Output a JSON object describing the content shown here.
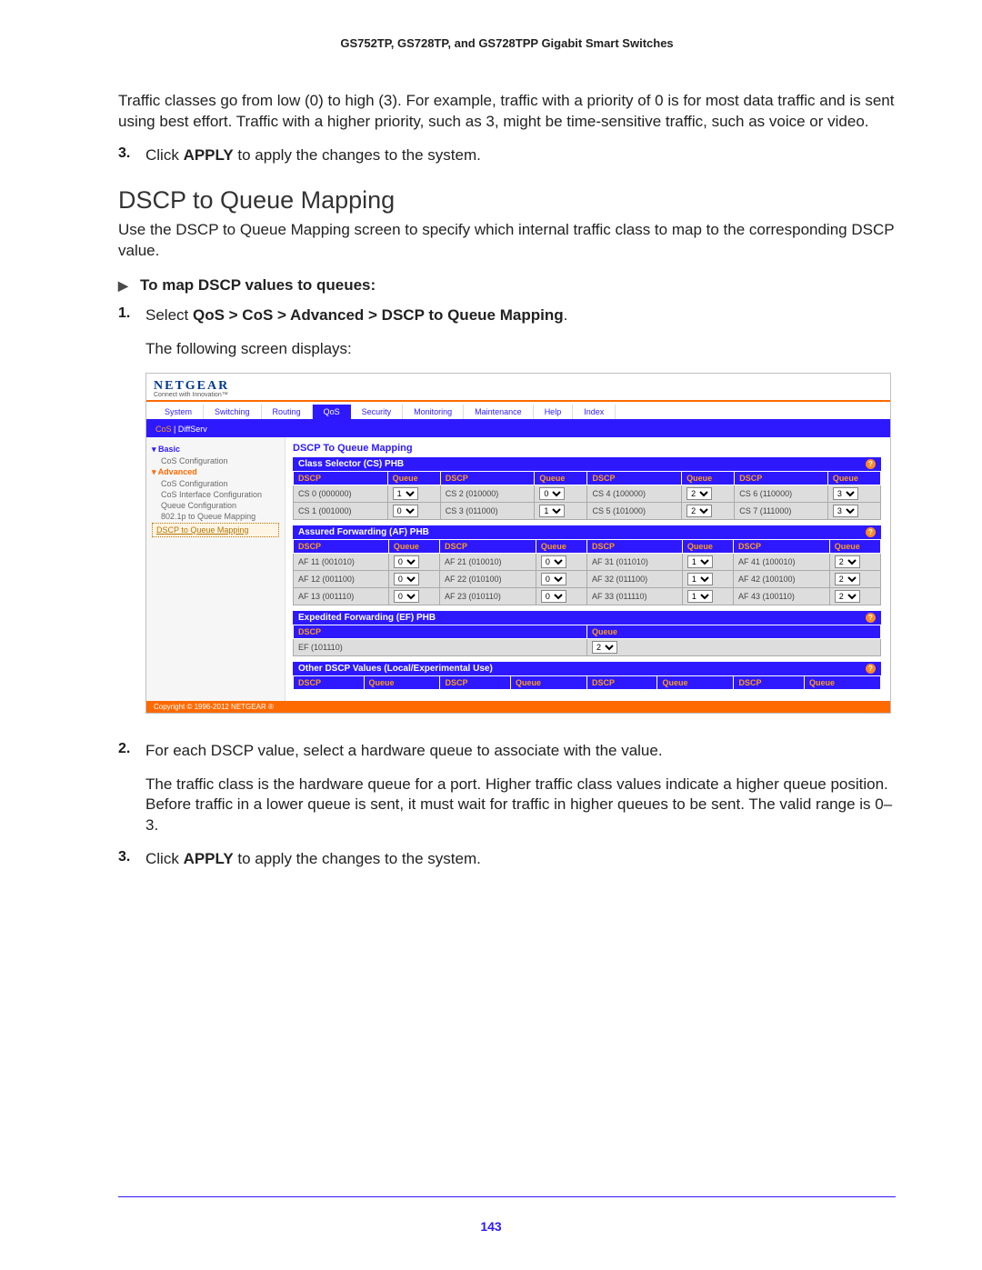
{
  "header": "GS752TP, GS728TP, and GS728TPP Gigabit Smart Switches",
  "intro_para": "Traffic classes go from low (0) to high (3). For example, traffic with a priority of 0 is for most data traffic and is sent using best effort. Traffic with a higher priority, such as 3, might be time-sensitive traffic, such as voice or video.",
  "step3_top_num": "3.",
  "step3_top_a": "Click ",
  "step3_top_b": "APPLY",
  "step3_top_c": " to apply the changes to the system.",
  "section_title": "DSCP to Queue Mapping",
  "section_intro": "Use the DSCP to Queue Mapping screen to specify which internal traffic class to map to the corresponding DSCP value.",
  "howto_label": "To map DSCP values to queues:",
  "step1_num": "1.",
  "step1_a": "Select ",
  "step1_path": "QoS > CoS > Advanced > DSCP to Queue Mapping",
  "step1_c": ".",
  "step1_follow": "The following screen displays:",
  "step2_num": "2.",
  "step2_a": "For each DSCP value, select a hardware queue to associate with the value.",
  "step2_para": "The traffic class is the hardware queue for a port. Higher traffic class values indicate a higher queue position. Before traffic in a lower queue is sent, it must wait for traffic in higher queues to be sent. The valid range is 0–3.",
  "step3_num": "3.",
  "step3_a": "Click ",
  "step3_b": "APPLY",
  "step3_c": " to apply the changes to the system.",
  "page_number": "143",
  "ui": {
    "brand": "NETGEAR",
    "tagline": "Connect with Innovation™",
    "tabs": [
      "System",
      "Switching",
      "Routing",
      "QoS",
      "Security",
      "Monitoring",
      "Maintenance",
      "Help",
      "Index"
    ],
    "active_tab_index": 3,
    "subnav_raw": "CoS | DiffServ",
    "subnav_active": "CoS",
    "sidebar": {
      "basic": {
        "heading": "Basic",
        "items": [
          "CoS Configuration"
        ]
      },
      "advanced": {
        "heading": "Advanced",
        "items": [
          "CoS Configuration",
          "CoS Interface Configuration",
          "Queue Configuration",
          "802.1p to Queue Mapping",
          "DSCP to Queue Mapping"
        ]
      }
    },
    "panel_title": "DSCP To Queue Mapping",
    "col_dscp": "DSCP",
    "col_queue": "Queue",
    "groups": {
      "cs": {
        "title": "Class Selector (CS) PHB",
        "rows": [
          [
            "CS 0 (000000)",
            "1",
            "CS 2 (010000)",
            "0",
            "CS 4 (100000)",
            "2",
            "CS 6 (110000)",
            "3"
          ],
          [
            "CS 1 (001000)",
            "0",
            "CS 3 (011000)",
            "1",
            "CS 5 (101000)",
            "2",
            "CS 7 (111000)",
            "3"
          ]
        ]
      },
      "af": {
        "title": "Assured Forwarding (AF) PHB",
        "rows": [
          [
            "AF 11 (001010)",
            "0",
            "AF 21 (010010)",
            "0",
            "AF 31 (011010)",
            "1",
            "AF 41 (100010)",
            "2"
          ],
          [
            "AF 12 (001100)",
            "0",
            "AF 22 (010100)",
            "0",
            "AF 32 (011100)",
            "1",
            "AF 42 (100100)",
            "2"
          ],
          [
            "AF 13 (001110)",
            "0",
            "AF 23 (010110)",
            "0",
            "AF 33 (011110)",
            "1",
            "AF 43 (100110)",
            "2"
          ]
        ]
      },
      "ef": {
        "title": "Expedited Forwarding (EF) PHB",
        "dscp": "EF (101110)",
        "queue": "2"
      },
      "other": {
        "title": "Other DSCP Values (Local/Experimental Use)"
      }
    },
    "footer": "Copyright © 1996-2012 NETGEAR ®"
  }
}
